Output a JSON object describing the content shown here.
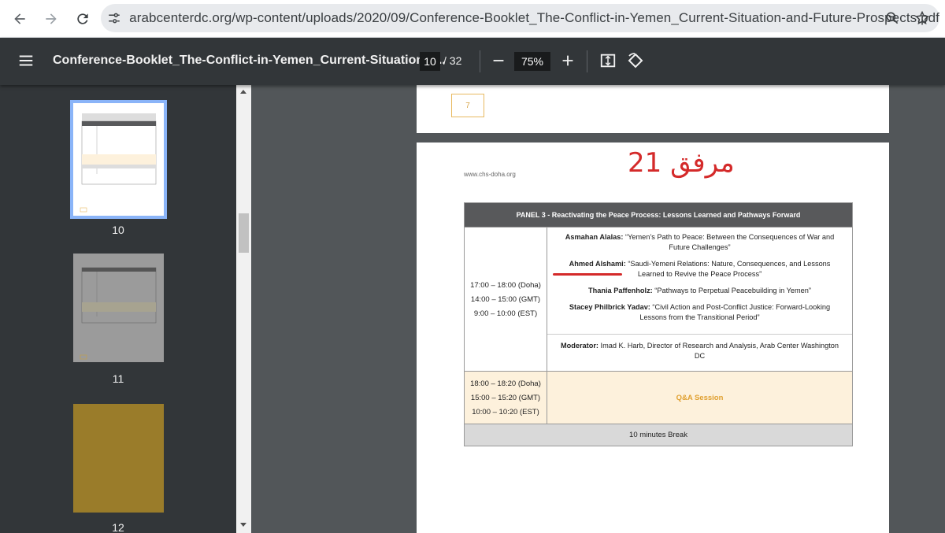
{
  "browser": {
    "url": "arabcenterdc.org/wp-content/uploads/2020/09/Conference-Booklet_The-Conflict-in-Yemen_Current-Situation-and-Future-Prospects.pdf"
  },
  "toolbar": {
    "title": "Conference-Booklet_The-Conflict-in-Yemen_Current-Situation-a...",
    "current_page": "10",
    "total_pages": "/ 32",
    "zoom": "75%"
  },
  "sidebar": {
    "thumbnails": [
      {
        "label": "10",
        "selected": true
      },
      {
        "label": "11",
        "selected": false
      },
      {
        "label": "12",
        "selected": false
      }
    ]
  },
  "page_prev": {
    "page_number": "7"
  },
  "page": {
    "site": "www.chs-doha.org",
    "annotation": "مرفق 21",
    "panel_title": "PANEL 3 - Reactivating the Peace Process: Lessons Learned and Pathways Forward",
    "times": [
      "17:00 – 18:00 (Doha)",
      "14:00 – 15:00 (GMT)",
      "9:00 – 10:00 (EST)"
    ],
    "talks": [
      {
        "speaker": "Asmahan Alalas:",
        "title": " “Yemen’s Path to Peace: Between the Consequences of War and Future Challenges”"
      },
      {
        "speaker": "Ahmed Alshami:",
        "title": " “Saudi-Yemeni Relations: Nature, Consequences, and Lessons Learned to Revive the Peace Process”"
      },
      {
        "speaker": "Thania Paffenholz:",
        "title": " “Pathways to Perpetual Peacebuilding in Yemen”"
      },
      {
        "speaker": "Stacey Philbrick Yadav:",
        "title": " “Civil Action and Post-Conflict Justice: Forward-Looking Lessons from the Transitional Period”"
      }
    ],
    "moderator": {
      "label": "Moderator:",
      "text": " Imad K. Harb, Director of Research and Analysis, Arab Center Washington DC"
    },
    "qa_times": [
      "18:00 – 18:20 (Doha)",
      "15:00 – 15:20 (GMT)",
      "10:00 – 10:20 (EST)"
    ],
    "qa_label": "Q&A Session",
    "break_label": "10 minutes Break"
  },
  "colors": {
    "annotation_red": "#d42a2a",
    "qa_gold": "#e0a030",
    "toolbar_bg": "#323639",
    "viewer_bg": "#525659"
  }
}
